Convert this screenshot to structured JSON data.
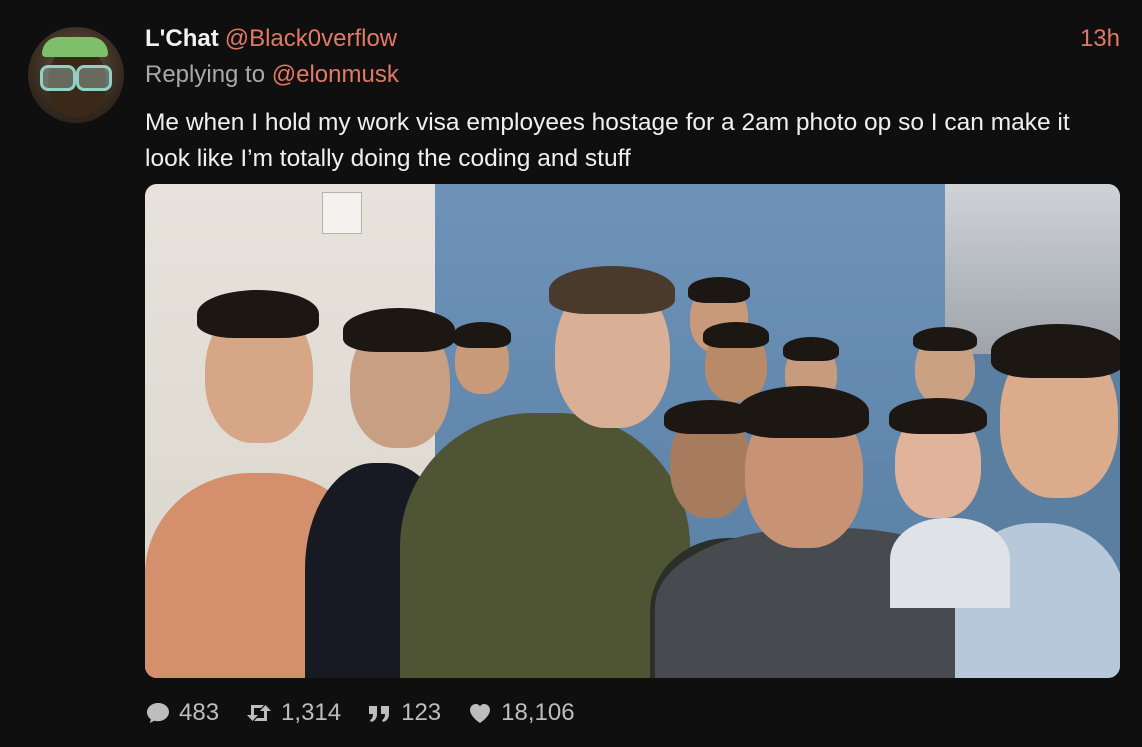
{
  "post": {
    "author": {
      "display_name": "L'Chat",
      "handle": "@Black0verflow"
    },
    "timestamp": "13h",
    "reply": {
      "prefix": "Replying to",
      "handle": "@elonmusk"
    },
    "text": "Me when I hold my work visa employees hostage for a 2am photo op so I can make it look like I’m totally doing the coding and stuff",
    "stats": {
      "replies": "483",
      "reposts": "1,314",
      "quotes": "123",
      "likes": "18,106"
    }
  },
  "icons": {
    "reply": "speech-bubble-icon",
    "repost": "repost-arrows-icon",
    "quote": "quote-marks-icon",
    "like": "heart-icon"
  },
  "colors": {
    "background": "#0f0f10",
    "accent": "#e07a64",
    "text_primary": "#f0f0f0",
    "text_secondary": "#a9a9a9"
  }
}
